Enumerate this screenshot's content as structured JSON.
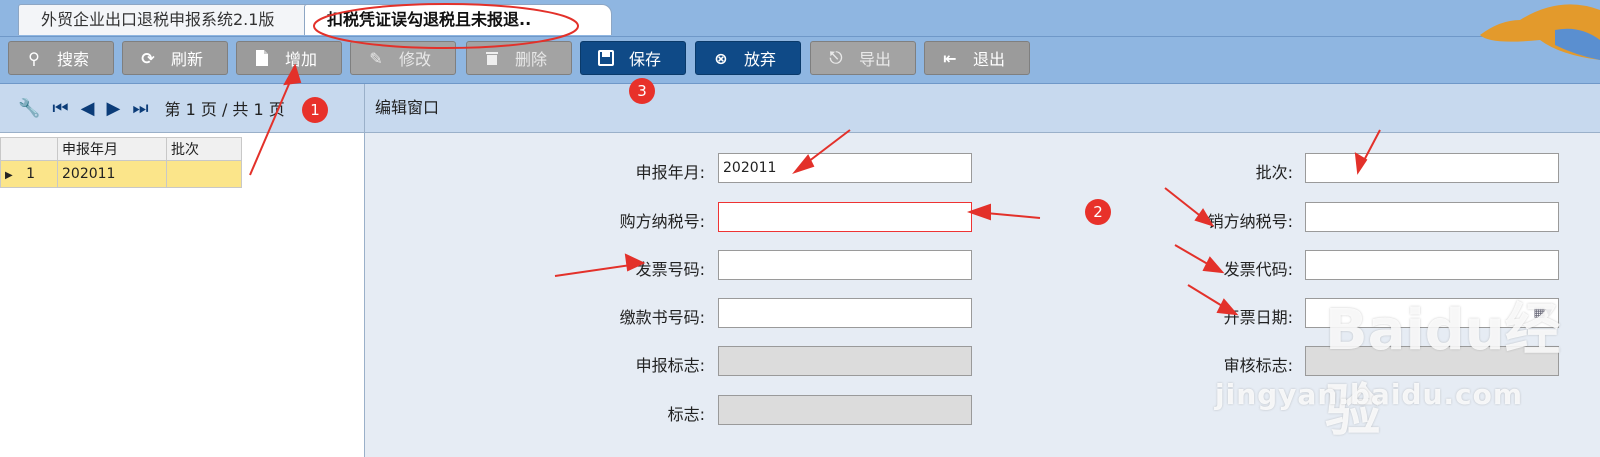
{
  "tabs": [
    {
      "label": "外贸企业出口退税申报系统2.1版"
    },
    {
      "label": "扣税凭证误勾退税且未报退.."
    }
  ],
  "toolbar": {
    "search": "搜索",
    "refresh": "刷新",
    "add": "增加",
    "edit": "修改",
    "delete": "删除",
    "save": "保存",
    "discard": "放弃",
    "export": "导出",
    "exit": "退出"
  },
  "pager": {
    "page_text": "第 1 页 / 共 1 页"
  },
  "grid": {
    "columns": [
      "申报年月",
      "批次"
    ],
    "rows": [
      {
        "index": "1",
        "period": "202011",
        "batch": ""
      }
    ]
  },
  "edit": {
    "header": "编辑窗口",
    "fields": {
      "period_label": "申报年月:",
      "period_value": "202011",
      "batch_label": "批次:",
      "buyer_tax_label": "购方纳税号:",
      "seller_tax_label": "销方纳税号:",
      "invoice_no_label": "发票号码:",
      "invoice_code_label": "发票代码:",
      "payment_no_label": "缴款书号码:",
      "invoice_date_label": "开票日期:",
      "declare_flag_label": "申报标志:",
      "audit_flag_label": "审核标志:",
      "flag_label": "标志:"
    }
  },
  "annotations": {
    "badge1": "1",
    "badge2": "2",
    "badge3": "3"
  },
  "watermark": {
    "brand": "Baidu经验",
    "url": "jingyan.baidu.com"
  }
}
